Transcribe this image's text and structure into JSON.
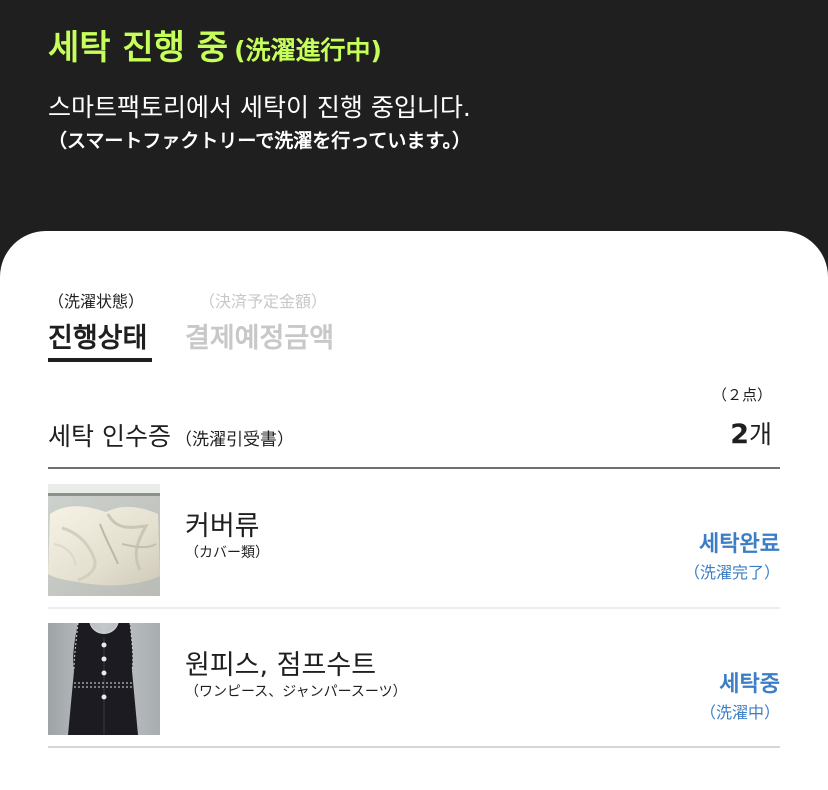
{
  "header": {
    "title": "세탁 진행 중",
    "title_sub": "(洗濯進行中)",
    "description": "스마트팩토리에서 세탁이 진행 중입니다.",
    "description_sub": "（スマートファクトリーで洗濯を行っています。）"
  },
  "tabs": [
    {
      "label": "진행상태",
      "sub": "（洗濯状態）",
      "active": true
    },
    {
      "label": "결제예정금액",
      "sub": "（決済予定金額）",
      "active": false
    }
  ],
  "receipt": {
    "label": "세탁 인수증",
    "label_sub": "（洗濯引受書）",
    "count_sub": "（２点）",
    "count": "2",
    "count_unit": "개"
  },
  "items": [
    {
      "name": "커버류",
      "name_sub": "（カバー類）",
      "status": "세탁완료",
      "status_sub": "（洗濯完了）",
      "thumbnail": "white-cover-fabric"
    },
    {
      "name": "원피스, 점프수트",
      "name_sub": "（ワンピース、ジャンパースーツ）",
      "status": "세탁중",
      "status_sub": "（洗濯中）",
      "thumbnail": "dark-jumpsuit"
    }
  ],
  "colors": {
    "header_bg": "#1f1f1f",
    "title_accent": "#c6ff5a",
    "status_blue": "#3b7ec6",
    "inactive_tab": "#c8c8c8"
  }
}
